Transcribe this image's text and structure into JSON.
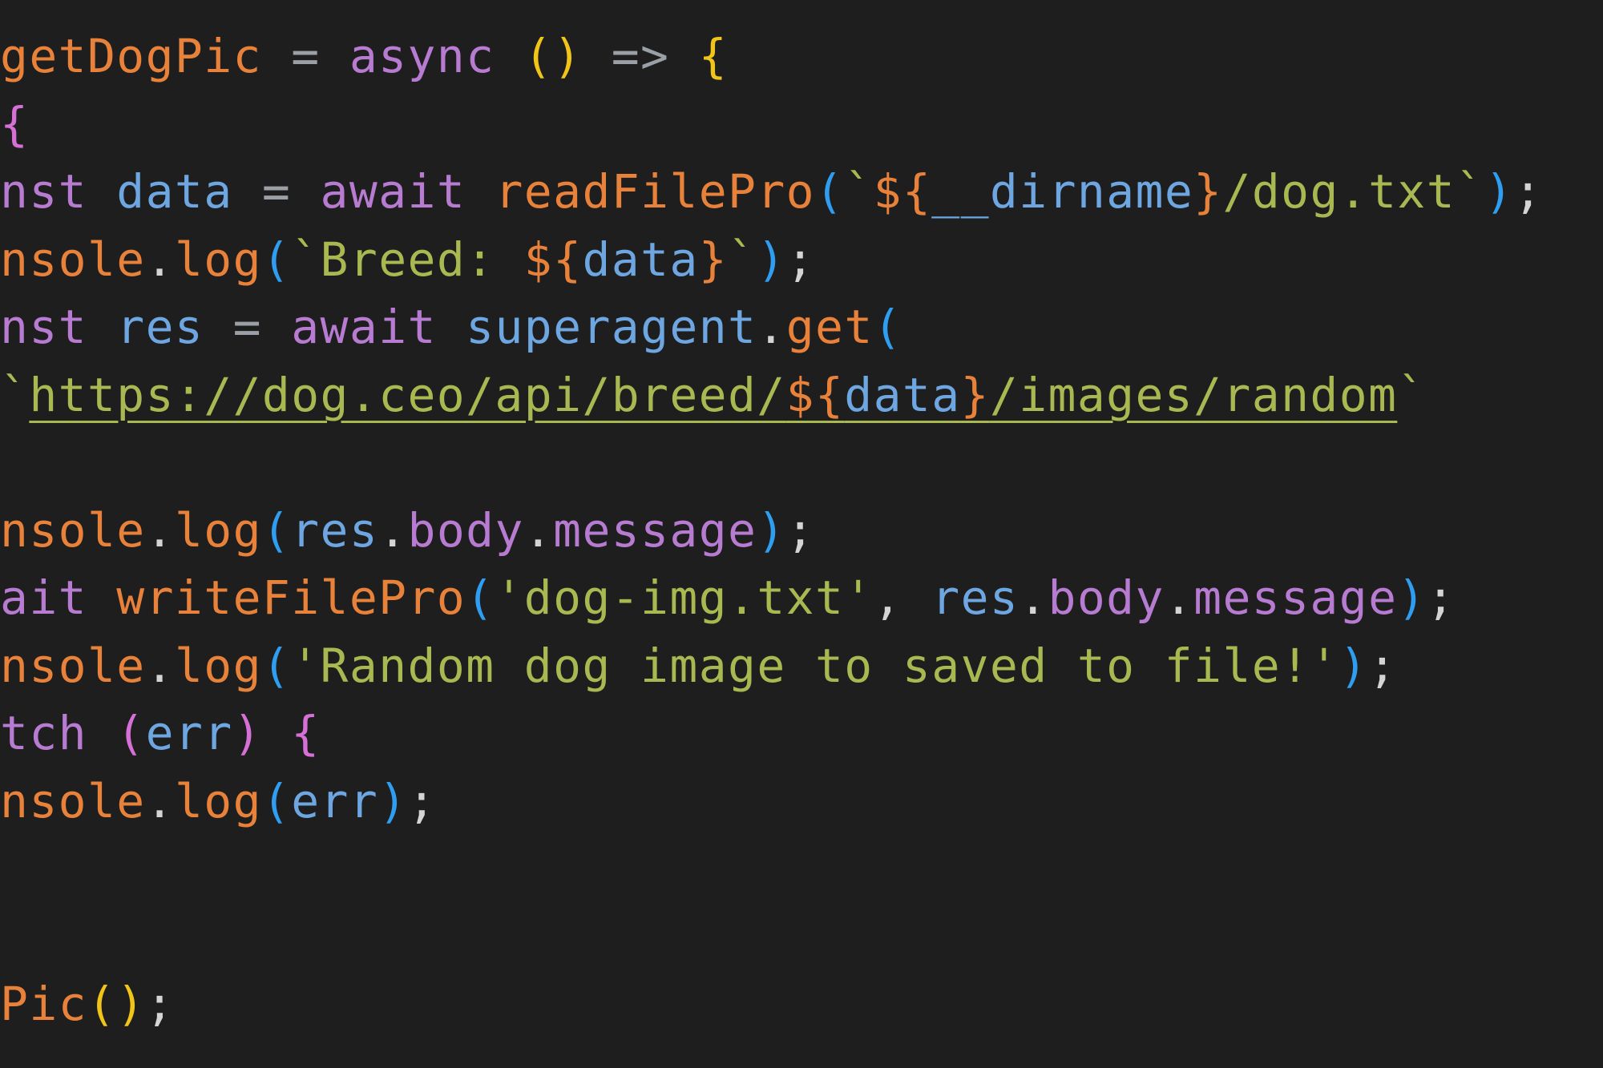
{
  "colors": {
    "background": "#1e1e1e",
    "function": "#e8823a",
    "keyword": "#b77bd1",
    "variable": "#6da6e0",
    "property": "#b77bd1",
    "string": "#a9b851",
    "template_brace": "#e8823a",
    "punctuation": "#d4d4d4",
    "paren_gold": "#f0c419",
    "paren_pink": "#d670d6",
    "paren_blue": "#2f9df0",
    "operator": "#9aa0a6"
  },
  "code": {
    "lines": [
      {
        "tokens": [
          {
            "t": "getDogPic",
            "c": "function"
          },
          {
            "t": " = ",
            "c": "operator"
          },
          {
            "t": "async",
            "c": "keyword"
          },
          {
            "t": " ",
            "c": "punctuation"
          },
          {
            "t": "()",
            "c": "paren_gold"
          },
          {
            "t": " => ",
            "c": "operator"
          },
          {
            "t": "{",
            "c": "paren_gold"
          }
        ]
      },
      {
        "tokens": [
          {
            "t": "{",
            "c": "paren_pink"
          }
        ]
      },
      {
        "tokens": [
          {
            "t": "nst",
            "c": "keyword"
          },
          {
            "t": " ",
            "c": "punctuation"
          },
          {
            "t": "data",
            "c": "variable"
          },
          {
            "t": " = ",
            "c": "operator"
          },
          {
            "t": "await",
            "c": "keyword"
          },
          {
            "t": " ",
            "c": "punctuation"
          },
          {
            "t": "readFilePro",
            "c": "function"
          },
          {
            "t": "(",
            "c": "paren_blue"
          },
          {
            "t": "`",
            "c": "string"
          },
          {
            "t": "${",
            "c": "template_brace"
          },
          {
            "t": "__dirname",
            "c": "variable"
          },
          {
            "t": "}",
            "c": "template_brace"
          },
          {
            "t": "/dog.txt`",
            "c": "string"
          },
          {
            "t": ")",
            "c": "paren_blue"
          },
          {
            "t": ";",
            "c": "punctuation"
          }
        ]
      },
      {
        "tokens": [
          {
            "t": "nsole",
            "c": "function"
          },
          {
            "t": ".",
            "c": "punctuation"
          },
          {
            "t": "log",
            "c": "function"
          },
          {
            "t": "(",
            "c": "paren_blue"
          },
          {
            "t": "`Breed: ",
            "c": "string"
          },
          {
            "t": "${",
            "c": "template_brace"
          },
          {
            "t": "data",
            "c": "variable"
          },
          {
            "t": "}",
            "c": "template_brace"
          },
          {
            "t": "`",
            "c": "string"
          },
          {
            "t": ")",
            "c": "paren_blue"
          },
          {
            "t": ";",
            "c": "punctuation"
          }
        ]
      },
      {
        "tokens": [
          {
            "t": "nst",
            "c": "keyword"
          },
          {
            "t": " ",
            "c": "punctuation"
          },
          {
            "t": "res",
            "c": "variable"
          },
          {
            "t": " = ",
            "c": "operator"
          },
          {
            "t": "await",
            "c": "keyword"
          },
          {
            "t": " ",
            "c": "punctuation"
          },
          {
            "t": "superagent",
            "c": "variable"
          },
          {
            "t": ".",
            "c": "punctuation"
          },
          {
            "t": "get",
            "c": "function"
          },
          {
            "t": "(",
            "c": "paren_blue"
          }
        ]
      },
      {
        "tokens": [
          {
            "t": "`",
            "c": "string"
          },
          {
            "t": "https://dog.ceo/api/breed/",
            "c": "string",
            "link": true
          },
          {
            "t": "${",
            "c": "template_brace",
            "link": true
          },
          {
            "t": "data",
            "c": "variable",
            "link": true
          },
          {
            "t": "}",
            "c": "template_brace",
            "link": true
          },
          {
            "t": "/images/random",
            "c": "string",
            "link": true
          },
          {
            "t": "`",
            "c": "string"
          }
        ]
      },
      {
        "tokens": []
      },
      {
        "tokens": [
          {
            "t": "nsole",
            "c": "function"
          },
          {
            "t": ".",
            "c": "punctuation"
          },
          {
            "t": "log",
            "c": "function"
          },
          {
            "t": "(",
            "c": "paren_blue"
          },
          {
            "t": "res",
            "c": "variable"
          },
          {
            "t": ".",
            "c": "punctuation"
          },
          {
            "t": "body",
            "c": "property"
          },
          {
            "t": ".",
            "c": "punctuation"
          },
          {
            "t": "message",
            "c": "property"
          },
          {
            "t": ")",
            "c": "paren_blue"
          },
          {
            "t": ";",
            "c": "punctuation"
          }
        ]
      },
      {
        "tokens": [
          {
            "t": "ait",
            "c": "keyword"
          },
          {
            "t": " ",
            "c": "punctuation"
          },
          {
            "t": "writeFilePro",
            "c": "function"
          },
          {
            "t": "(",
            "c": "paren_blue"
          },
          {
            "t": "'dog-img.txt'",
            "c": "string"
          },
          {
            "t": ", ",
            "c": "punctuation"
          },
          {
            "t": "res",
            "c": "variable"
          },
          {
            "t": ".",
            "c": "punctuation"
          },
          {
            "t": "body",
            "c": "property"
          },
          {
            "t": ".",
            "c": "punctuation"
          },
          {
            "t": "message",
            "c": "property"
          },
          {
            "t": ")",
            "c": "paren_blue"
          },
          {
            "t": ";",
            "c": "punctuation"
          }
        ]
      },
      {
        "tokens": [
          {
            "t": "nsole",
            "c": "function"
          },
          {
            "t": ".",
            "c": "punctuation"
          },
          {
            "t": "log",
            "c": "function"
          },
          {
            "t": "(",
            "c": "paren_blue"
          },
          {
            "t": "'Random dog image to saved to file!'",
            "c": "string"
          },
          {
            "t": ")",
            "c": "paren_blue"
          },
          {
            "t": ";",
            "c": "punctuation"
          }
        ]
      },
      {
        "tokens": [
          {
            "t": "tch",
            "c": "keyword"
          },
          {
            "t": " ",
            "c": "punctuation"
          },
          {
            "t": "(",
            "c": "paren_pink"
          },
          {
            "t": "err",
            "c": "variable"
          },
          {
            "t": ")",
            "c": "paren_pink"
          },
          {
            "t": " ",
            "c": "punctuation"
          },
          {
            "t": "{",
            "c": "paren_pink"
          }
        ]
      },
      {
        "tokens": [
          {
            "t": "nsole",
            "c": "function"
          },
          {
            "t": ".",
            "c": "punctuation"
          },
          {
            "t": "log",
            "c": "function"
          },
          {
            "t": "(",
            "c": "paren_blue"
          },
          {
            "t": "err",
            "c": "variable"
          },
          {
            "t": ")",
            "c": "paren_blue"
          },
          {
            "t": ";",
            "c": "punctuation"
          }
        ]
      },
      {
        "tokens": []
      },
      {
        "tokens": []
      },
      {
        "tokens": [
          {
            "t": "Pic",
            "c": "function"
          },
          {
            "t": "()",
            "c": "paren_gold"
          },
          {
            "t": ";",
            "c": "punctuation"
          }
        ]
      }
    ]
  }
}
